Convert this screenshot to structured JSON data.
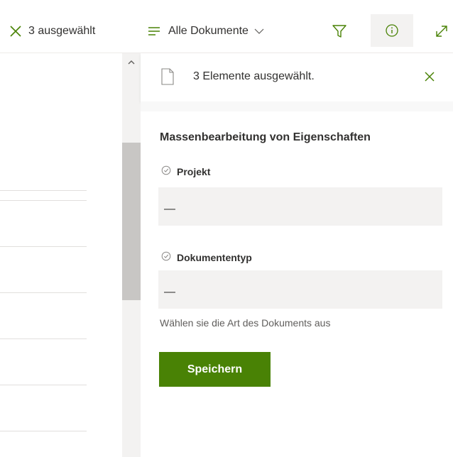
{
  "toolbar": {
    "clear_selection_label": "3 ausgewählt",
    "view_label": "Alle Dokumente",
    "icons": {
      "clear": "close-icon",
      "view": "list-view-icon",
      "view_dropdown": "chevron-down-icon",
      "filter": "filter-icon",
      "info": "info-icon",
      "expand": "expand-icon"
    }
  },
  "panel": {
    "header_title": "3 Elemente ausgewählt.",
    "section_title": "Massenbearbeitung von Eigenschaften",
    "fields": [
      {
        "label": "Projekt",
        "value": "—"
      },
      {
        "label": "Dokumententyp",
        "value": "—",
        "help": "Wählen sie die Art des Dokuments aus"
      }
    ],
    "save_label": "Speichern"
  },
  "colors": {
    "accent_green": "#498205",
    "icon_green": "#498205",
    "field_bg": "#f3f2f1",
    "text": "#323130"
  }
}
